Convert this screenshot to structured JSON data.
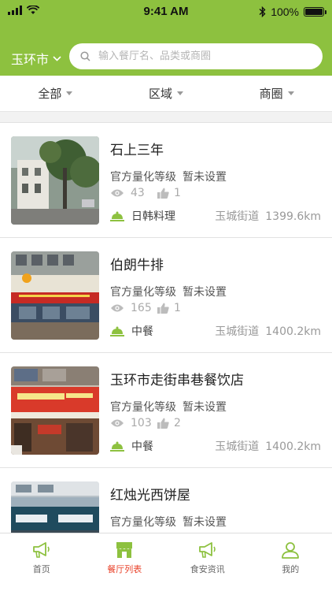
{
  "status_bar": {
    "time": "9:41 AM",
    "battery": "100%"
  },
  "header": {
    "city": "玉环市",
    "search_placeholder": "输入餐厅名、品类或商圈"
  },
  "filters": [
    {
      "label": "全部"
    },
    {
      "label": "区域"
    },
    {
      "label": "商圈"
    }
  ],
  "restaurants": [
    {
      "name": "石上三年",
      "grade_label": "官方量化等级",
      "grade_value": "暂未设置",
      "views": "43",
      "likes": "1",
      "cuisine": "日韩料理",
      "street": "玉城街道",
      "distance": "1399.6km"
    },
    {
      "name": "伯朗牛排",
      "grade_label": "官方量化等级",
      "grade_value": "暂未设置",
      "views": "165",
      "likes": "1",
      "cuisine": "中餐",
      "street": "玉城街道",
      "distance": "1400.2km"
    },
    {
      "name": "玉环市走街串巷餐饮店",
      "grade_label": "官方量化等级",
      "grade_value": "暂未设置",
      "views": "103",
      "likes": "2",
      "cuisine": "中餐",
      "street": "玉城街道",
      "distance": "1400.2km"
    },
    {
      "name": "红烛光西饼屋",
      "grade_label": "官方量化等级",
      "grade_value": "暂未设置",
      "views": "",
      "likes": "",
      "cuisine": "",
      "street": "",
      "distance": ""
    }
  ],
  "tabbar": [
    {
      "label": "首页",
      "icon": "megaphone-icon"
    },
    {
      "label": "餐厅列表",
      "icon": "storefront-icon",
      "active": true
    },
    {
      "label": "食安资讯",
      "icon": "megaphone-icon"
    },
    {
      "label": "我的",
      "icon": "person-icon"
    }
  ],
  "colors": {
    "brand": "#8dc13f",
    "active_tab": "#e9432b"
  }
}
